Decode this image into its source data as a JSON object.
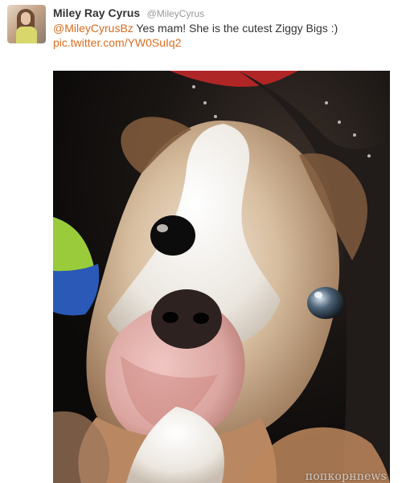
{
  "tweet": {
    "display_name": "Miley Ray Cyrus",
    "username": "@MileyCyrus",
    "mention": "@MileyCyrusBz",
    "message": " Yes mam! She is the cutest Ziggy Bigs :)",
    "link": "pic.twitter.com/YW0SuIq2"
  },
  "watermark": "попкорнnews",
  "colors": {
    "link": "#d96b1f",
    "name": "#333333",
    "handle": "#999999"
  },
  "icons": {
    "avatar": "profile-picture",
    "photo": "puppy-photo"
  }
}
